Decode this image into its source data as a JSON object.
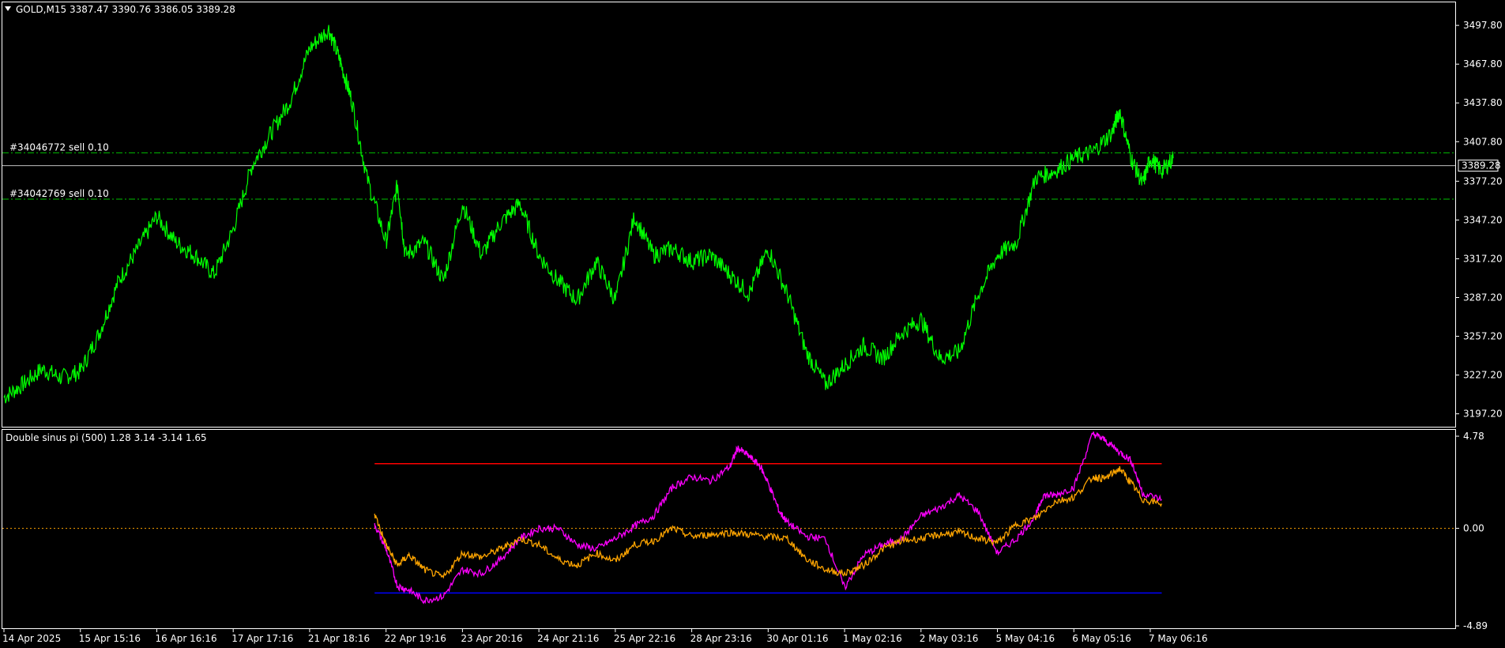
{
  "header": {
    "symbol": "GOLD,M15",
    "ohlc": "3387.47 3390.76 3386.05 3389.28"
  },
  "indicator": {
    "label": "Double sinus pi (500) 1.28 3.14 -3.14 1.65"
  },
  "orders": [
    {
      "label": "#34046772 sell 0.10",
      "price": 3399.2
    },
    {
      "label": "#34042769 sell 0.10",
      "price": 3363.3
    }
  ],
  "current_price": {
    "label": "3389.28",
    "value": 3389.28
  },
  "colors": {
    "background": "#000000",
    "frame": "#ffffff",
    "price_line": "#00ff00",
    "order_line": "#00c000",
    "pink_series": "#ff00ff",
    "orange_series": "#ffa500",
    "upper_level": "#ff0000",
    "lower_level": "#0000ff",
    "zero_level": "#ffa500"
  },
  "chart_data": [
    {
      "type": "line",
      "pane": "price",
      "ylim": [
        3187.2,
        3515.0
      ],
      "y_ticks": [
        "3497.80",
        "3467.80",
        "3437.80",
        "3407.80",
        "3377.20",
        "3347.20",
        "3317.20",
        "3287.20",
        "3257.20",
        "3227.20",
        "3197.20"
      ],
      "y_tick_values": [
        3497.8,
        3467.8,
        3437.8,
        3407.8,
        3377.2,
        3347.2,
        3317.2,
        3287.2,
        3257.2,
        3227.2,
        3197.2
      ],
      "x_ticks": [
        "14 Apr 2025",
        "15 Apr 15:16",
        "16 Apr 16:16",
        "17 Apr 17:16",
        "21 Apr 18:16",
        "22 Apr 19:16",
        "23 Apr 20:16",
        "24 Apr 21:16",
        "25 Apr 22:16",
        "28 Apr 23:16",
        "30 Apr 01:16",
        "1 May 02:16",
        "2 May 03:16",
        "5 May 04:16",
        "6 May 05:16",
        "7 May 06:16"
      ],
      "x_tick_index": [
        0,
        1,
        2,
        3,
        4,
        5,
        6,
        7,
        8,
        9,
        10,
        11,
        12,
        13,
        14,
        15
      ],
      "x_end_index": 15.3,
      "series": [
        {
          "color": "#00ff00",
          "x": [
            0,
            0.25,
            0.5,
            0.75,
            1,
            1.25,
            1.5,
            1.75,
            2,
            2.25,
            2.5,
            2.75,
            3,
            3.25,
            3.5,
            3.75,
            4,
            4.25,
            4.4,
            4.55,
            4.75,
            5,
            5.15,
            5.25,
            5.5,
            5.75,
            6,
            6.25,
            6.5,
            6.75,
            7,
            7.25,
            7.5,
            7.75,
            8,
            8.25,
            8.5,
            8.75,
            9,
            9.25,
            9.5,
            9.75,
            10,
            10.25,
            10.5,
            10.75,
            11,
            11.25,
            11.5,
            11.75,
            12,
            12.25,
            12.5,
            12.75,
            13,
            13.25,
            13.5,
            13.75,
            14,
            14.25,
            14.5,
            14.6,
            14.75,
            14.9,
            15,
            15.15,
            15.3
          ],
          "y": [
            3210,
            3220,
            3232,
            3225,
            3230,
            3260,
            3300,
            3325,
            3350,
            3330,
            3320,
            3305,
            3340,
            3390,
            3415,
            3440,
            3480,
            3495,
            3470,
            3440,
            3380,
            3330,
            3375,
            3320,
            3330,
            3300,
            3360,
            3320,
            3345,
            3360,
            3320,
            3300,
            3285,
            3315,
            3285,
            3350,
            3320,
            3325,
            3315,
            3320,
            3305,
            3290,
            3325,
            3290,
            3245,
            3220,
            3235,
            3250,
            3240,
            3260,
            3270,
            3240,
            3245,
            3290,
            3320,
            3330,
            3380,
            3385,
            3395,
            3400,
            3415,
            3432,
            3395,
            3375,
            3395,
            3385,
            3395
          ]
        }
      ]
    },
    {
      "type": "line",
      "pane": "indicator",
      "ylim": [
        -4.89,
        4.78
      ],
      "y_ticks": [
        "4.78",
        "0.00",
        "-4.89"
      ],
      "y_tick_values": [
        4.78,
        0.0,
        -4.89
      ],
      "levels": [
        {
          "value": 3.14,
          "color": "#ff0000"
        },
        {
          "value": 0.0,
          "color": "#ffa500"
        },
        {
          "value": -3.14,
          "color": "#0000ff"
        }
      ],
      "series": [
        {
          "color": "#ff00ff",
          "x": [
            4.85,
            5.0,
            5.15,
            5.3,
            5.5,
            5.75,
            6.0,
            6.25,
            6.5,
            6.75,
            7.0,
            7.25,
            7.5,
            7.75,
            8.0,
            8.25,
            8.5,
            8.75,
            9.0,
            9.25,
            9.5,
            9.6,
            9.75,
            9.9,
            10.0,
            10.15,
            10.25,
            10.5,
            10.75,
            11.0,
            11.25,
            11.5,
            11.75,
            12.0,
            12.25,
            12.5,
            12.75,
            13.0,
            13.25,
            13.5,
            13.6,
            13.75,
            14.0,
            14.25,
            14.4,
            14.6,
            14.75,
            14.9,
            15.15
          ],
          "y": [
            0.2,
            -1.0,
            -2.8,
            -3.0,
            -3.5,
            -3.3,
            -2.0,
            -2.2,
            -1.5,
            -0.5,
            0.0,
            0.0,
            -0.8,
            -1.0,
            -0.5,
            0.1,
            0.6,
            2.0,
            2.5,
            2.3,
            3.0,
            3.9,
            3.5,
            3.0,
            2.2,
            0.8,
            0.3,
            -0.4,
            -0.5,
            -2.9,
            -1.3,
            -0.8,
            -0.5,
            0.6,
            1.0,
            1.6,
            0.8,
            -1.2,
            -0.5,
            0.6,
            1.6,
            1.6,
            2.0,
            4.6,
            4.3,
            3.7,
            3.3,
            1.7,
            1.4
          ]
        },
        {
          "color": "#ffa500",
          "x": [
            4.85,
            5.0,
            5.15,
            5.3,
            5.5,
            5.75,
            6.0,
            6.25,
            6.5,
            6.75,
            7.0,
            7.25,
            7.5,
            7.75,
            8.0,
            8.25,
            8.5,
            8.75,
            9.0,
            9.25,
            9.5,
            9.75,
            10.0,
            10.25,
            10.5,
            10.75,
            11.0,
            11.25,
            11.5,
            11.75,
            12.0,
            12.25,
            12.5,
            12.75,
            13.0,
            13.25,
            13.5,
            13.75,
            14.0,
            14.25,
            14.4,
            14.6,
            14.75,
            14.9,
            15.15
          ],
          "y": [
            0.7,
            -0.8,
            -1.8,
            -1.3,
            -2.0,
            -2.4,
            -1.2,
            -1.4,
            -1.0,
            -0.5,
            -0.8,
            -1.5,
            -1.8,
            -1.2,
            -1.6,
            -0.8,
            -0.6,
            0.0,
            -0.4,
            -0.3,
            -0.2,
            -0.3,
            -0.4,
            -0.5,
            -1.5,
            -2.0,
            -2.2,
            -1.8,
            -1.0,
            -0.6,
            -0.5,
            -0.3,
            -0.2,
            -0.5,
            -0.7,
            0.2,
            0.5,
            1.3,
            1.5,
            2.5,
            2.4,
            2.9,
            2.2,
            1.4,
            1.2
          ]
        }
      ]
    }
  ]
}
